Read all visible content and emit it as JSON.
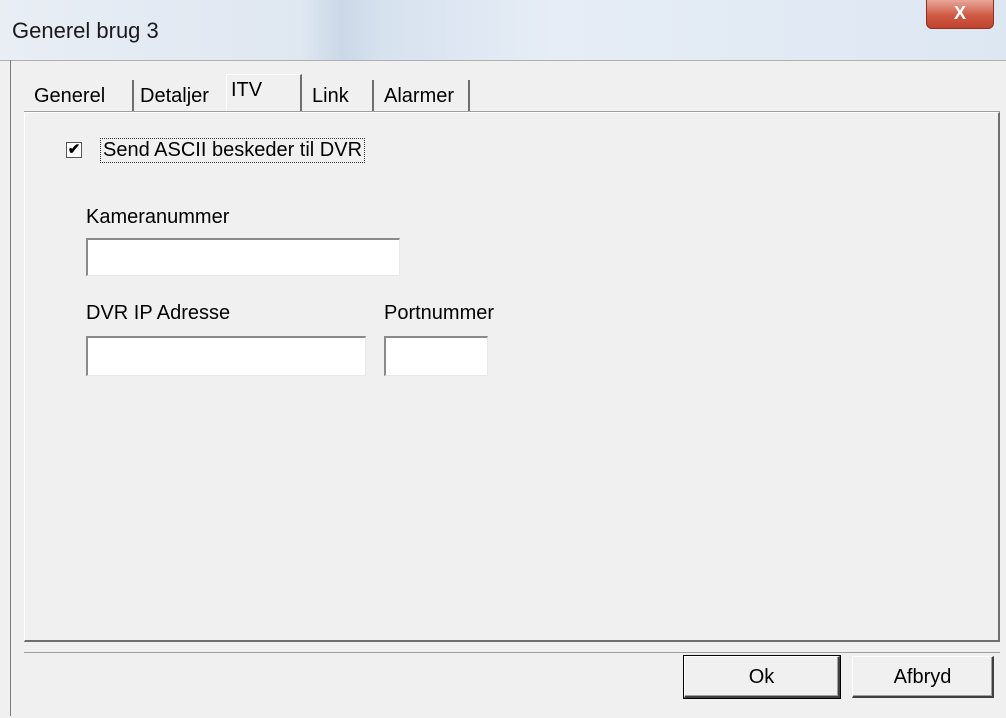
{
  "window": {
    "title": "Generel brug 3",
    "close_label": "X"
  },
  "tabs": [
    {
      "label": "Generel"
    },
    {
      "label": "Detaljer"
    },
    {
      "label": "ITV"
    },
    {
      "label": "Link"
    },
    {
      "label": "Alarmer"
    }
  ],
  "active_tab": "ITV",
  "itv": {
    "send_ascii": {
      "label": "Send ASCII beskeder til DVR",
      "checked": true,
      "mark": "✔"
    },
    "camera_number": {
      "label": "Kameranummer",
      "value": ""
    },
    "dvr_ip": {
      "label": "DVR IP Adresse",
      "value": ""
    },
    "port_number": {
      "label": "Portnummer",
      "value": ""
    }
  },
  "buttons": {
    "ok": "Ok",
    "cancel": "Afbryd"
  }
}
